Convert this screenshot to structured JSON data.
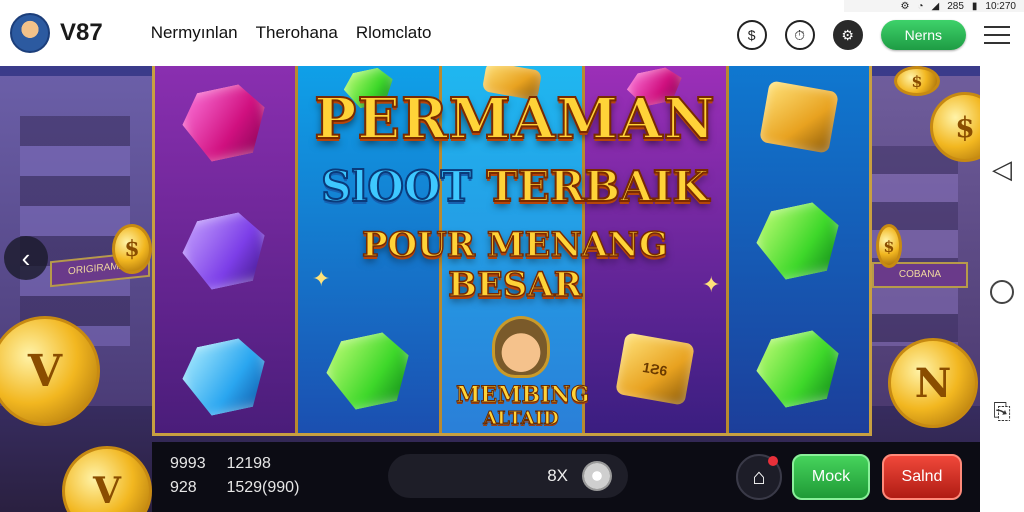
{
  "status_bar": {
    "icons": [
      "gear-icon",
      "clock-icon",
      "signal-icon",
      "battery-icon"
    ],
    "indicators": "285",
    "time": "10:270"
  },
  "header": {
    "brand": "V87",
    "nav": [
      "Nermyınlan",
      "Therohana",
      "Rlomclato"
    ],
    "news_label": "Nerns",
    "accent": "#2fbe57"
  },
  "game": {
    "title_line1": "PERMAMAN",
    "title_line2_a": "SlOOT",
    "title_line2_b": "TERBAIK",
    "title_line3": "POUR MENANG BESAR",
    "badge_line1": "MEMBING",
    "badge_line2": "ALTAID",
    "box_label": "1Ƨ6",
    "sign_left": "ORIGIRAMAS",
    "sign_right": "COBANA"
  },
  "bottom": {
    "row1_a": "9993",
    "row1_b": "12198",
    "row2_a": "928",
    "row2_b": "1529(990)",
    "multiplier": "8X",
    "mock_label": "Mock",
    "saldo_label": "Salnd"
  }
}
